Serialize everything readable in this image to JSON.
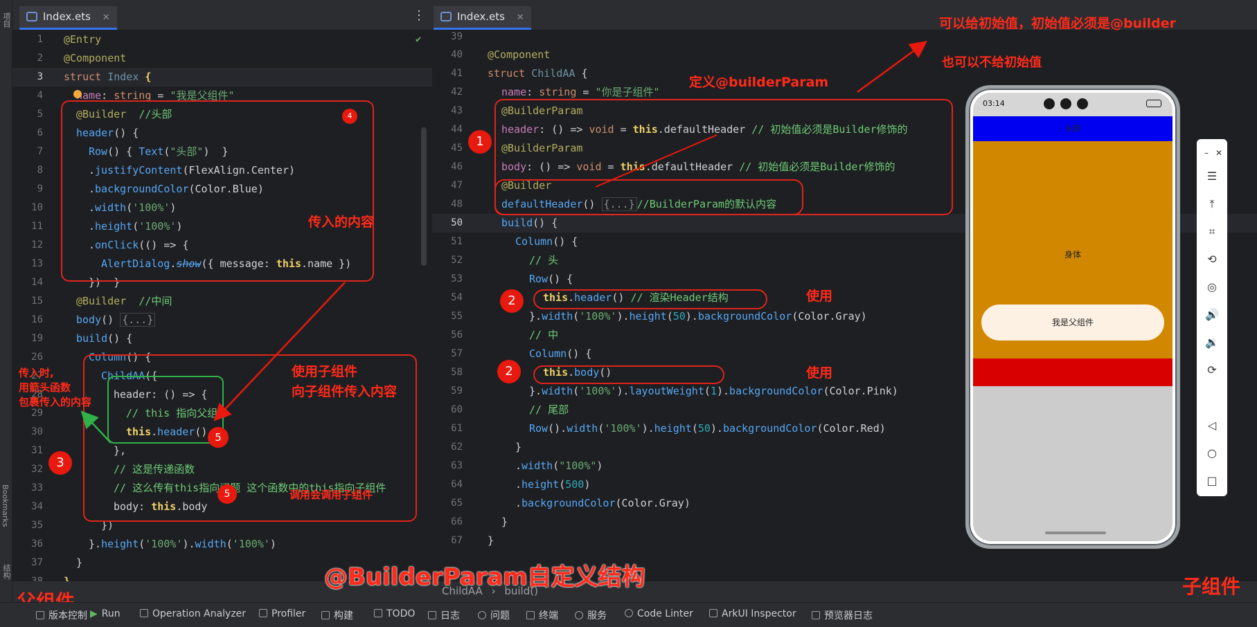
{
  "left_strip": {
    "top_label": "项目",
    "bookmarks": "Bookmarks",
    "structure": "结构"
  },
  "left_pane": {
    "tab_label": "Index.ets",
    "tab_close": "✕",
    "menu_icon": "⋮",
    "lines": [
      {
        "n": "1"
      },
      {
        "n": "2"
      },
      {
        "n": "3"
      },
      {
        "n": "4"
      },
      {
        "n": "5"
      },
      {
        "n": "6"
      },
      {
        "n": "7"
      },
      {
        "n": "8"
      },
      {
        "n": "9"
      },
      {
        "n": "10"
      },
      {
        "n": "11"
      },
      {
        "n": "12"
      },
      {
        "n": "13"
      },
      {
        "n": "14"
      },
      {
        "n": "15"
      },
      {
        "n": "16"
      },
      {
        "n": "19"
      },
      {
        "n": "26"
      },
      {
        "n": "27"
      },
      {
        "n": "28"
      },
      {
        "n": "29"
      },
      {
        "n": "30"
      },
      {
        "n": "31"
      },
      {
        "n": "32"
      },
      {
        "n": "33"
      },
      {
        "n": "34"
      },
      {
        "n": "35"
      },
      {
        "n": "36"
      },
      {
        "n": "37"
      },
      {
        "n": "38"
      }
    ]
  },
  "right_pane": {
    "tab_label": "Index.ets",
    "tab_close": "✕",
    "lines": [
      {
        "n": "39"
      },
      {
        "n": "40"
      },
      {
        "n": "41"
      },
      {
        "n": "42"
      },
      {
        "n": "43"
      },
      {
        "n": "44"
      },
      {
        "n": "45"
      },
      {
        "n": "46"
      },
      {
        "n": "47"
      },
      {
        "n": "48"
      },
      {
        "n": "50"
      },
      {
        "n": "51"
      },
      {
        "n": "52"
      },
      {
        "n": "53"
      },
      {
        "n": "54"
      },
      {
        "n": "55"
      },
      {
        "n": "56"
      },
      {
        "n": "57"
      },
      {
        "n": "58"
      },
      {
        "n": "59"
      },
      {
        "n": "60"
      },
      {
        "n": "61"
      },
      {
        "n": "62"
      },
      {
        "n": "63"
      },
      {
        "n": "64"
      },
      {
        "n": "65"
      },
      {
        "n": "66"
      },
      {
        "n": "67"
      }
    ]
  },
  "annotations": {
    "initial_value_note": "可以给初始值，初始值必须是@builder",
    "no_initial_value": "也可以不给初始值",
    "define_builder_param": "定义@builderParam",
    "use_1": "使用",
    "use_2": "使用",
    "passed_content": "传入的内容",
    "use_child": "使用子组件",
    "pass_to_child": "向子组件传入内容",
    "arrow_fn_1": "传入时,",
    "arrow_fn_2": "用箭头函数",
    "arrow_fn_3": "包裹传入的内容",
    "call_child": "调用会调用子组件",
    "title": "@BuilderParam自定义结构",
    "parent_label": "父组件",
    "child_label": "子组件",
    "badge_1": "1",
    "badge_2a": "2",
    "badge_2b": "2",
    "badge_3": "3",
    "badge_4": "4",
    "badge_5a": "5",
    "badge_5b": "5"
  },
  "breadcrumb": {
    "first": "ChildAA",
    "separator": "›",
    "second": "build()"
  },
  "statusbar": {
    "items": [
      "版本控制",
      "Run",
      "Operation Analyzer",
      "Profiler",
      "构建",
      "TODO",
      "日志",
      "问题",
      "终端",
      "服务",
      "Code Linter",
      "ArkUI Inspector",
      "预览器日志"
    ]
  },
  "phone": {
    "time": "03:14",
    "header_text": "头部",
    "body_text": "身体",
    "button_text": "我是父组件",
    "colors": {
      "header": "#0000f0",
      "body": "#d18800",
      "footer": "#d80000",
      "background": "#cccccc"
    }
  },
  "emulator_toolbar": {
    "minimize": "–",
    "close": "✕",
    "icons": [
      "menu-icon",
      "pin-top-icon",
      "crop-icon",
      "rotate-icon",
      "screenshot-icon",
      "volume-up-icon",
      "volume-down-icon",
      "shake-icon",
      "back-icon",
      "home-icon",
      "recent-apps-icon"
    ]
  }
}
